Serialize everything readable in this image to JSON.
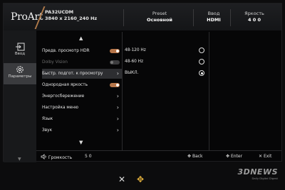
{
  "header": {
    "logo": "ProArt",
    "model": "PA32UCDM",
    "resolution": "3840 x 2160_240 Hz",
    "preset_label": "Preset",
    "preset_value": "Основной",
    "input_label": "Ввод",
    "input_value": "HDMI",
    "brightness_label": "Яркость",
    "brightness_value": "4 0 0"
  },
  "sidebar": {
    "items": [
      {
        "label": "Ввод",
        "icon": "input-icon"
      },
      {
        "label": "Параметры",
        "icon": "gear-icon"
      }
    ]
  },
  "menu": {
    "items": [
      {
        "label": "Предв. просмотр HDR",
        "control": "toggle",
        "state": "on"
      },
      {
        "label": "Dolby Vision",
        "control": "toggle",
        "state": "off",
        "disabled": true
      },
      {
        "label": "Быстр. подгот. к просмотру",
        "control": "chevron",
        "selected": true
      },
      {
        "label": "Однородная яркость",
        "control": "toggle",
        "state": "on"
      },
      {
        "label": "Энергосбережение",
        "control": "chevron"
      },
      {
        "label": "Настройка меню",
        "control": "chevron"
      },
      {
        "label": "Язык",
        "control": "chevron"
      },
      {
        "label": "Звук",
        "control": "chevron"
      }
    ]
  },
  "options": {
    "items": [
      {
        "label": "48-120 Hz",
        "selected": false
      },
      {
        "label": "48-60 Hz",
        "selected": false
      },
      {
        "label": "ВЫКЛ.",
        "selected": true
      }
    ]
  },
  "footer": {
    "volume_label": "Громкость",
    "volume_value": "5 0",
    "back_label": "Back",
    "enter_label": "Enter",
    "exit_label": "Exit"
  },
  "watermark": {
    "brand": "3DNEWS",
    "tagline": "Daily Digital Digest"
  },
  "colors": {
    "accent": "#b7764a",
    "background": "#060607",
    "selected_row": "#2d2e31"
  }
}
